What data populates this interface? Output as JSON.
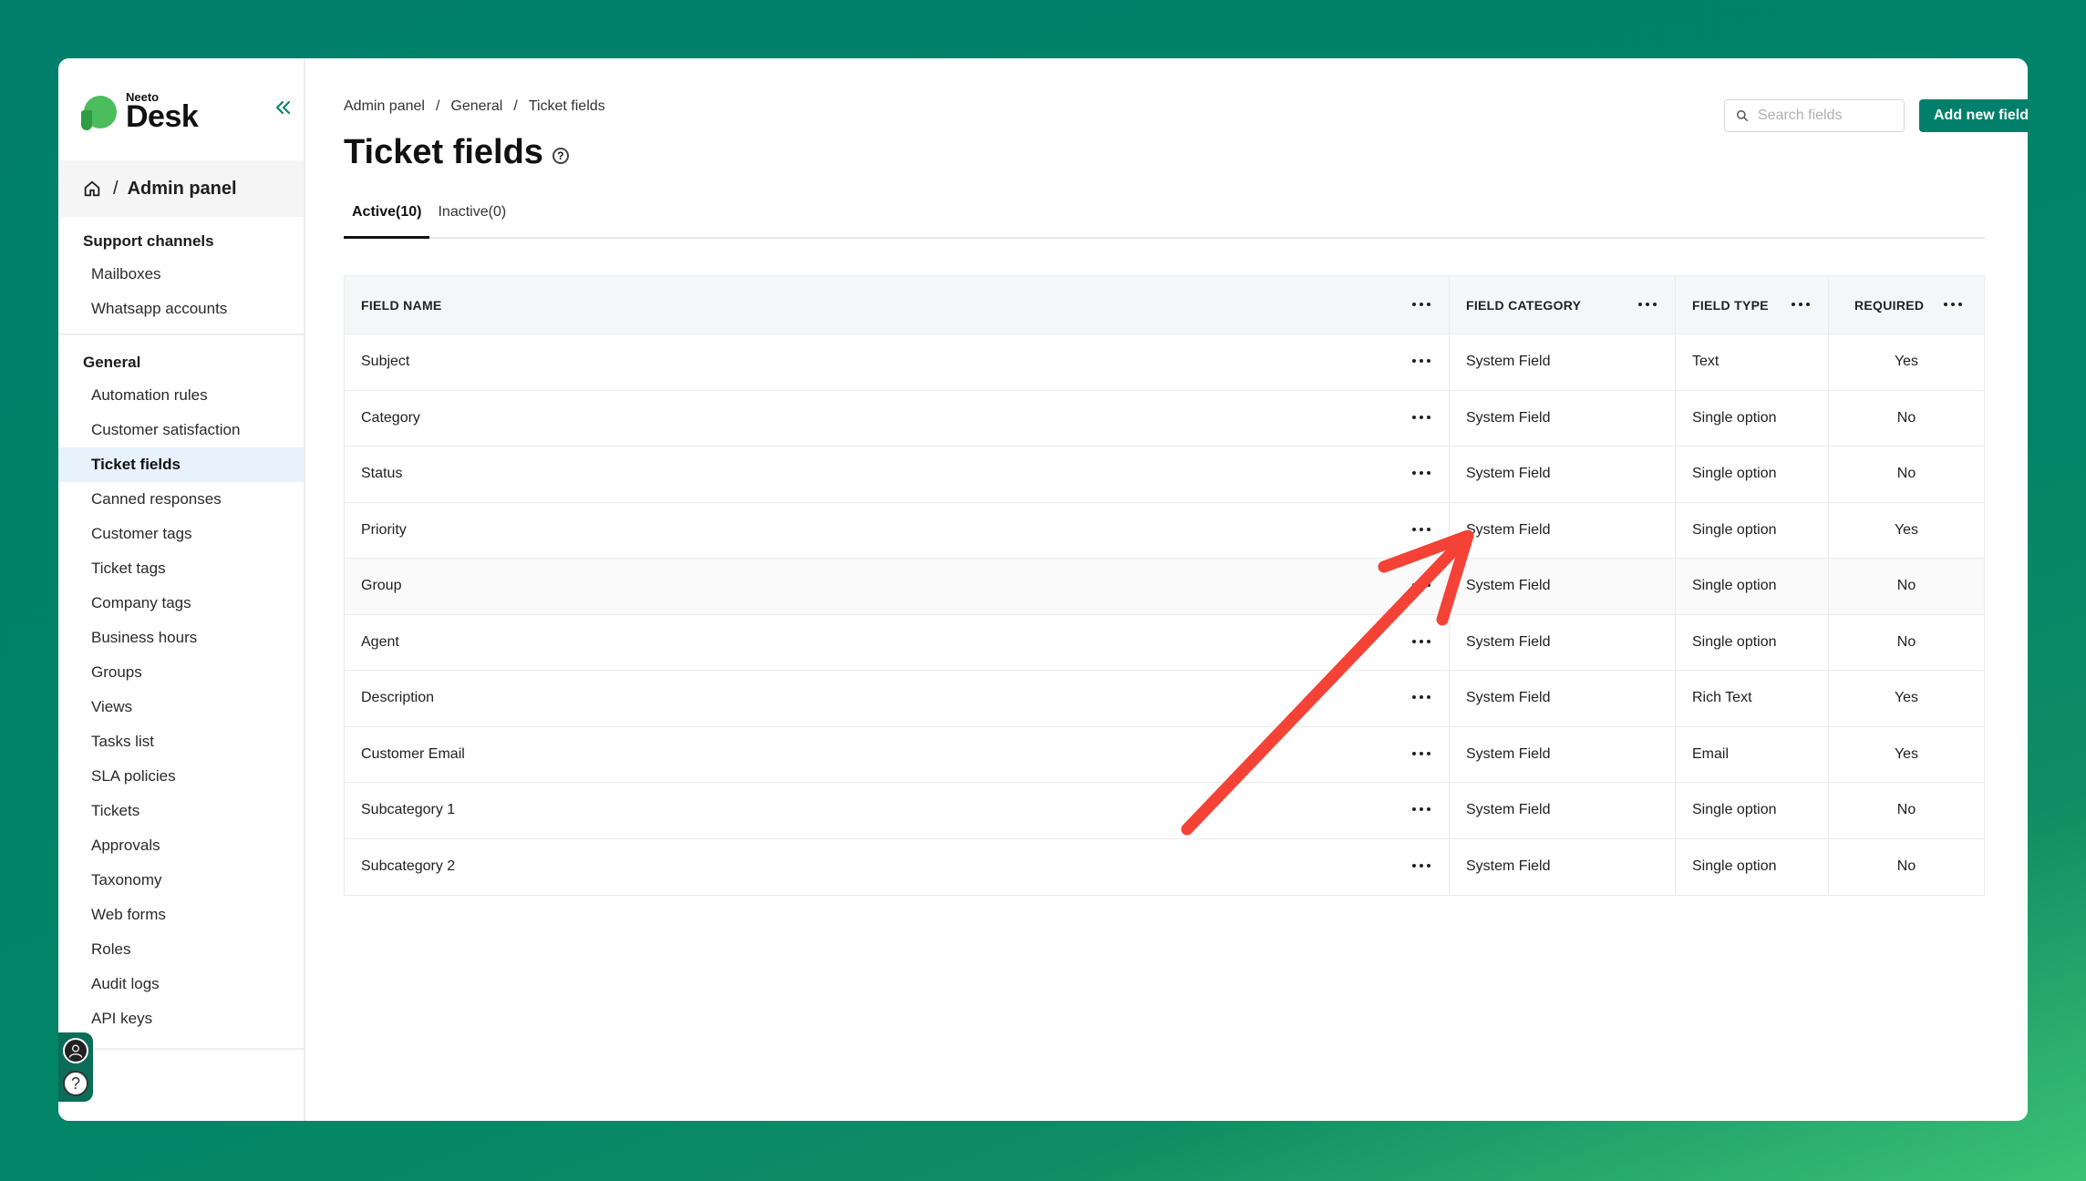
{
  "app": {
    "logo_small": "Neeto",
    "logo_big": "Desk"
  },
  "sidebar": {
    "crumb_sep": "/",
    "crumb_label": "Admin panel",
    "sections": [
      {
        "heading": "Support channels",
        "items": [
          "Mailboxes",
          "Whatsapp accounts"
        ]
      },
      {
        "heading": "General",
        "items": [
          "Automation rules",
          "Customer satisfaction",
          "Ticket fields",
          "Canned responses",
          "Customer tags",
          "Ticket tags",
          "Company tags",
          "Business hours",
          "Groups",
          "Views",
          "Tasks list",
          "SLA policies",
          "Tickets",
          "Approvals",
          "Taxonomy",
          "Web forms",
          "Roles",
          "Audit logs",
          "API keys"
        ]
      }
    ],
    "active_item": "Ticket fields",
    "help_glyph": "?"
  },
  "breadcrumb": {
    "items": [
      "Admin panel",
      "General",
      "Ticket fields"
    ],
    "sep": "/"
  },
  "page": {
    "title": "Ticket fields",
    "help_glyph": "?"
  },
  "search": {
    "placeholder": "Search fields"
  },
  "add_button": {
    "label": "Add new field"
  },
  "tabs": [
    {
      "label": "Active(10)",
      "active": true
    },
    {
      "label": "Inactive(0)",
      "active": false
    }
  ],
  "table": {
    "headers": [
      "FIELD NAME",
      "FIELD CATEGORY",
      "FIELD TYPE",
      "REQUIRED"
    ],
    "rows": [
      [
        "Subject",
        "System Field",
        "Text",
        "Yes"
      ],
      [
        "Category",
        "System Field",
        "Single option",
        "No"
      ],
      [
        "Status",
        "System Field",
        "Single option",
        "No"
      ],
      [
        "Priority",
        "System Field",
        "Single option",
        "Yes"
      ],
      [
        "Group",
        "System Field",
        "Single option",
        "No"
      ],
      [
        "Agent",
        "System Field",
        "Single option",
        "No"
      ],
      [
        "Description",
        "System Field",
        "Rich Text",
        "Yes"
      ],
      [
        "Customer Email",
        "System Field",
        "Email",
        "Yes"
      ],
      [
        "Subcategory 1",
        "System Field",
        "Single option",
        "No"
      ],
      [
        "Subcategory 2",
        "System Field",
        "Single option",
        "No"
      ]
    ]
  },
  "colors": {
    "brand": "#00806a",
    "annotation_arrow": "#f44336",
    "active_nav_bg": "#e8f2fc"
  }
}
